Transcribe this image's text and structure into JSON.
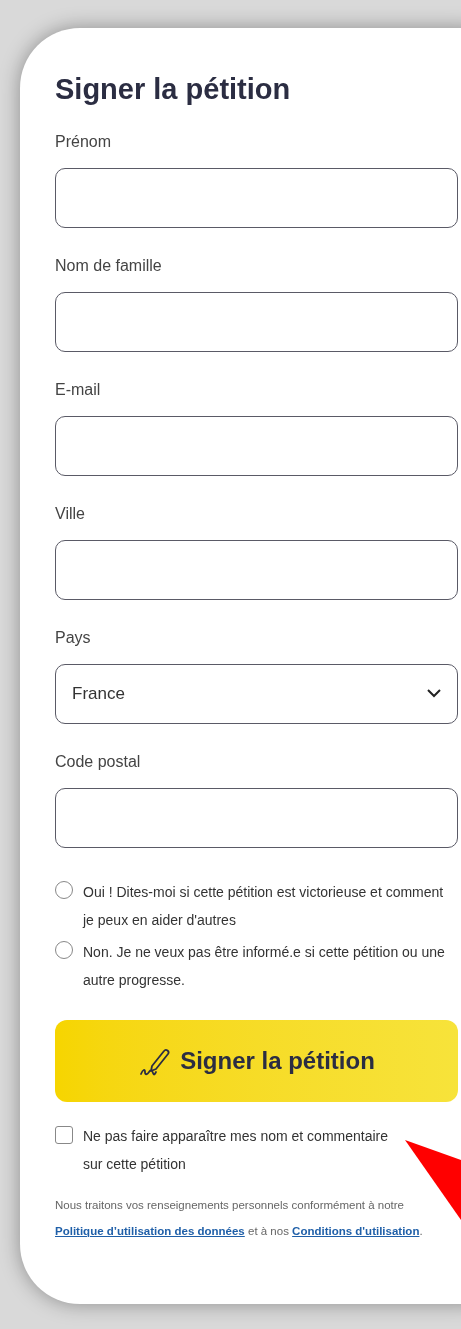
{
  "title": "Signer la pétition",
  "fields": [
    {
      "kind": "text",
      "label": "Prénom"
    },
    {
      "kind": "text",
      "label": "Nom de famille"
    },
    {
      "kind": "text",
      "label": "E-mail"
    },
    {
      "kind": "text",
      "label": "Ville"
    },
    {
      "kind": "select",
      "label": "Pays",
      "value": "France"
    },
    {
      "kind": "text",
      "label": "Code postal"
    }
  ],
  "options": [
    {
      "label": "Oui ! Dites-moi si cette pétition est victorieuse et comment je peux en aider d'autres",
      "selected": false
    },
    {
      "label": "Non. Je ne veux pas être informé.e si cette pétition ou une autre progresse.",
      "selected": false
    }
  ],
  "submit": {
    "label": "Signer la pétition"
  },
  "hide_name": {
    "label": "Ne pas faire apparaître mes nom et commentaire sur cette pétition",
    "checked": false
  },
  "privacy": {
    "before": "Nous traitons vos renseignements personnels conformément à notre",
    "link_1": "Politique d’utilisation des données",
    "middle": "et à nos",
    "link_2": "Conditions d'utilisation",
    "end": "."
  }
}
